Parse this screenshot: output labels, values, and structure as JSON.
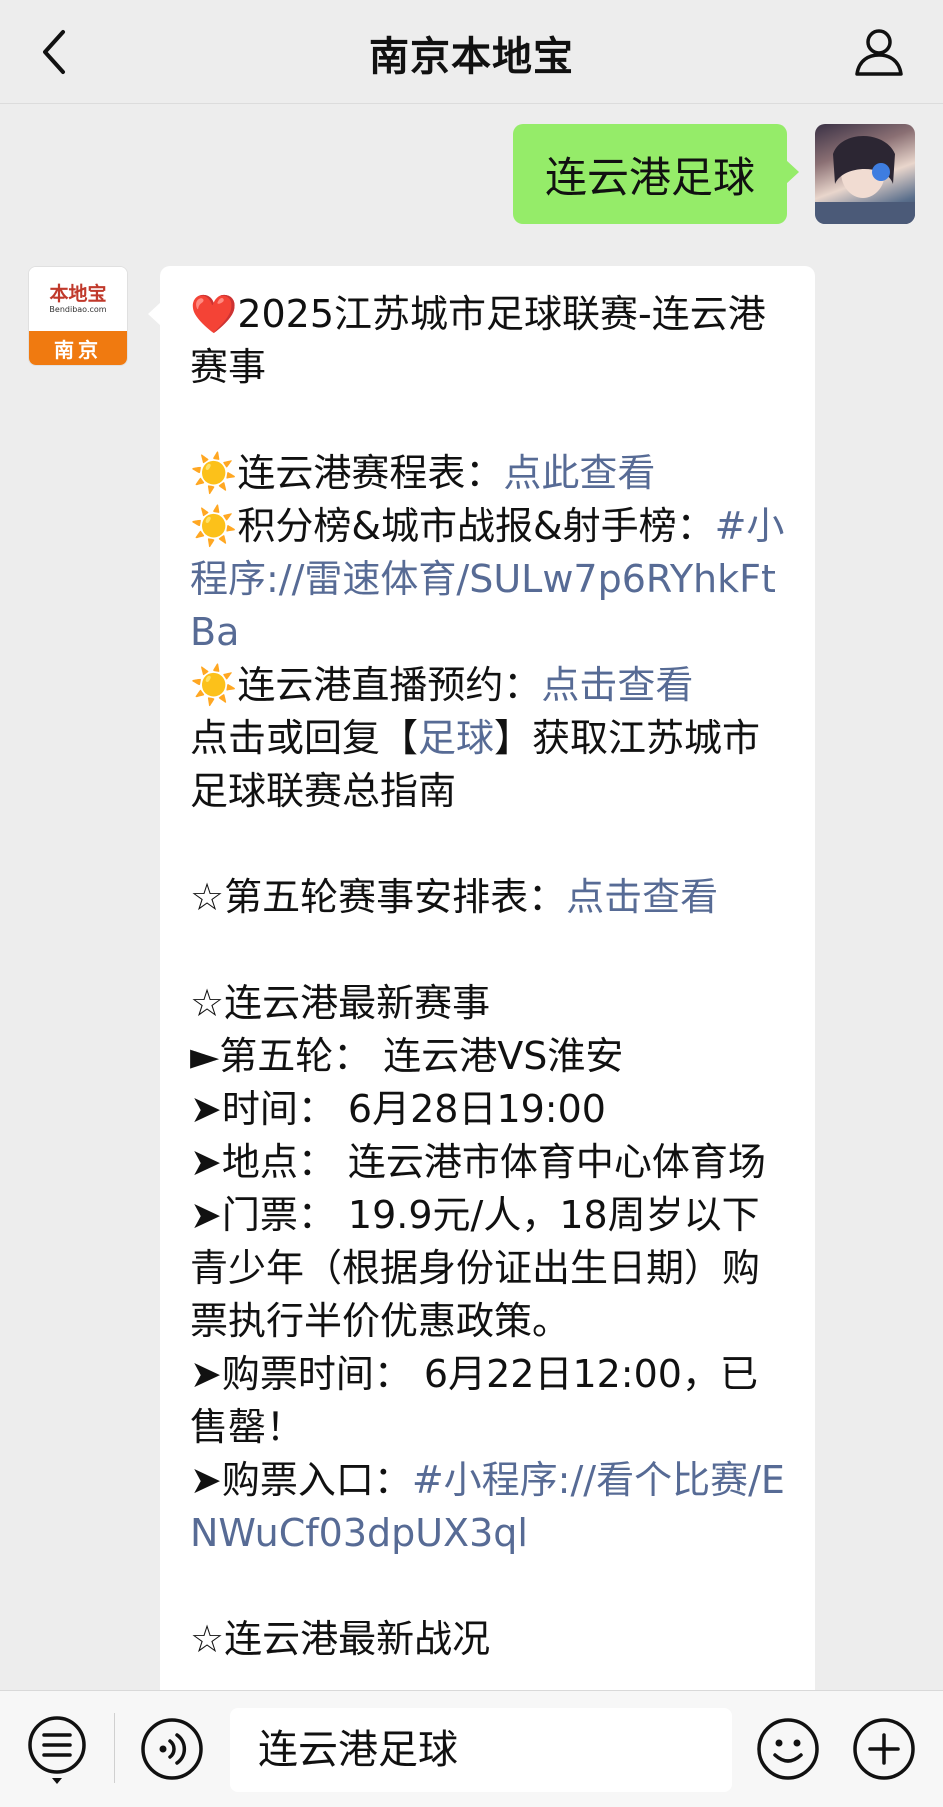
{
  "header": {
    "title": "南京本地宝"
  },
  "outgoing": {
    "text": "连云港足球"
  },
  "brand_avatar": {
    "name": "本地宝",
    "url": "Bendibao.com",
    "city": "南京"
  },
  "message": {
    "heading_icon": "❤️",
    "heading_text": "2025江苏城市足球联赛-连云港赛事",
    "schedule_label": "连云港赛程表：",
    "schedule_link": "点此查看",
    "rank_label": "积分榜&城市战报&射手榜：",
    "rank_link": "#小程序://雷速体育/SULw7p6RYhkFtBa",
    "live_label": "连云港直播预约：",
    "live_link": "点击查看",
    "guide_prefix": "点击或回复【",
    "guide_link": "足球",
    "guide_suffix": "】获取江苏城市足球联赛总指南",
    "round5_label": "☆第五轮赛事安排表：",
    "round5_link": "点击查看",
    "latest_title": "☆连云港最新赛事",
    "match_line": "►第五轮：  连云港VS淮安",
    "time_line": "➤时间：  6月28日19:00",
    "venue_line": "➤地点：  连云港市体育中心体育场",
    "ticket_line": "➤门票：  19.9元/人，18周岁以下青少年（根据身份证出生日期）购票执行半价优惠政策。",
    "ticket_time_line": "➤购票时间：  6月22日12:00，已售罄！",
    "entry_label": "➤购票入口：",
    "entry_link": "#小程序://看个比赛/ENWuCf03dpUX3ql",
    "cut_line": "☆连云港最新战况"
  },
  "input": {
    "text": "连云港足球"
  },
  "colors": {
    "bubble_out": "#95ec69",
    "link": "#576b95",
    "background": "#ededed"
  },
  "icons": [
    "back-arrow-icon",
    "profile-icon",
    "menu-list-icon",
    "voice-icon",
    "emoji-icon",
    "plus-icon",
    "sun-emoji-icon"
  ]
}
